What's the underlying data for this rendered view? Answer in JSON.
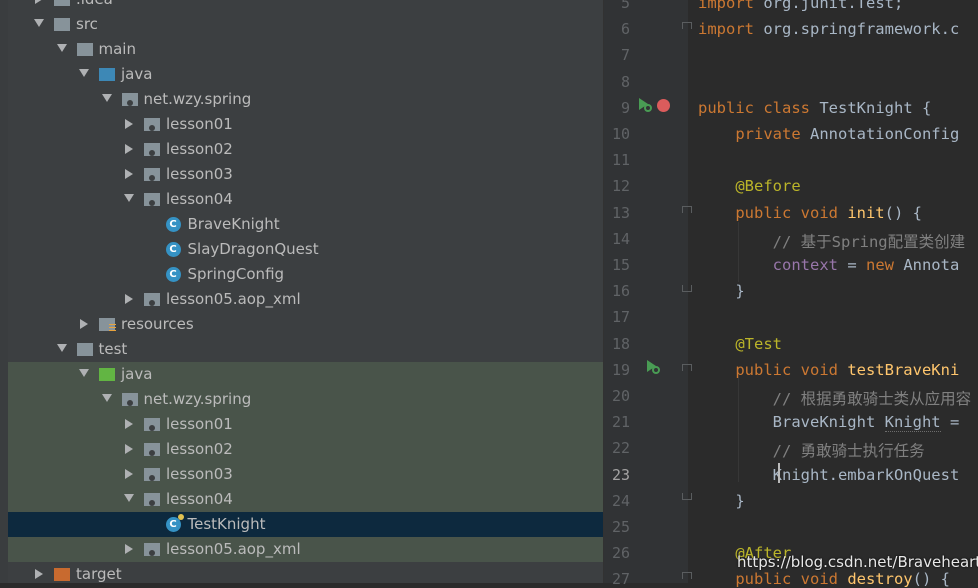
{
  "project_tree": {
    "rows": [
      {
        "label": ".idea",
        "indent": 0,
        "expanded": false,
        "kind": "folder-gray"
      },
      {
        "label": "src",
        "indent": 0,
        "expanded": true,
        "kind": "folder-gray"
      },
      {
        "label": "main",
        "indent": 1,
        "expanded": true,
        "kind": "folder-gray"
      },
      {
        "label": "java",
        "indent": 2,
        "expanded": true,
        "kind": "folder-blue"
      },
      {
        "label": "net.wzy.spring",
        "indent": 3,
        "expanded": true,
        "kind": "package"
      },
      {
        "label": "lesson01",
        "indent": 4,
        "expanded": false,
        "kind": "package"
      },
      {
        "label": "lesson02",
        "indent": 4,
        "expanded": false,
        "kind": "package"
      },
      {
        "label": "lesson03",
        "indent": 4,
        "expanded": false,
        "kind": "package"
      },
      {
        "label": "lesson04",
        "indent": 4,
        "expanded": true,
        "kind": "package"
      },
      {
        "label": "BraveKnight",
        "indent": 5,
        "expanded": null,
        "kind": "class"
      },
      {
        "label": "SlayDragonQuest",
        "indent": 5,
        "expanded": null,
        "kind": "class"
      },
      {
        "label": "SpringConfig",
        "indent": 5,
        "expanded": null,
        "kind": "class"
      },
      {
        "label": "lesson05.aop_xml",
        "indent": 4,
        "expanded": false,
        "kind": "package"
      },
      {
        "label": "resources",
        "indent": 2,
        "expanded": false,
        "kind": "folder-resources"
      },
      {
        "label": "test",
        "indent": 1,
        "expanded": true,
        "kind": "folder-gray"
      },
      {
        "label": "java",
        "indent": 2,
        "expanded": true,
        "kind": "folder-green"
      },
      {
        "label": "net.wzy.spring",
        "indent": 3,
        "expanded": true,
        "kind": "package"
      },
      {
        "label": "lesson01",
        "indent": 4,
        "expanded": false,
        "kind": "package"
      },
      {
        "label": "lesson02",
        "indent": 4,
        "expanded": false,
        "kind": "package"
      },
      {
        "label": "lesson03",
        "indent": 4,
        "expanded": false,
        "kind": "package"
      },
      {
        "label": "lesson04",
        "indent": 4,
        "expanded": true,
        "kind": "package"
      },
      {
        "label": "TestKnight",
        "indent": 5,
        "expanded": null,
        "kind": "test-class",
        "selected": true
      },
      {
        "label": "lesson05.aop_xml",
        "indent": 4,
        "expanded": false,
        "kind": "package"
      },
      {
        "label": "target",
        "indent": 0,
        "expanded": false,
        "kind": "folder-orange"
      }
    ]
  },
  "editor": {
    "current_line": 23,
    "lines": [
      {
        "n": "5",
        "tokens": [
          [
            "kw",
            "import "
          ],
          [
            "plain",
            "org.junit."
          ],
          [
            "plain",
            "Test"
          ],
          [
            "plain",
            ";"
          ]
        ]
      },
      {
        "n": "6",
        "tokens": [
          [
            "kw",
            "import "
          ],
          [
            "plain",
            "org.springframework.c"
          ]
        ]
      },
      {
        "n": "7",
        "tokens": []
      },
      {
        "n": "8",
        "tokens": []
      },
      {
        "n": "9",
        "tokens": [
          [
            "kw",
            "public class "
          ],
          [
            "plain",
            "TestKnight {"
          ]
        ]
      },
      {
        "n": "10",
        "tokens": [
          [
            "plain",
            "    "
          ],
          [
            "kw",
            "private "
          ],
          [
            "plain",
            "AnnotationConfig"
          ]
        ]
      },
      {
        "n": "11",
        "tokens": []
      },
      {
        "n": "12",
        "tokens": [
          [
            "plain",
            "    "
          ],
          [
            "ann",
            "@Before"
          ]
        ]
      },
      {
        "n": "13",
        "tokens": [
          [
            "plain",
            "    "
          ],
          [
            "kw",
            "public void "
          ],
          [
            "fn",
            "init"
          ],
          [
            "plain",
            "() {"
          ]
        ]
      },
      {
        "n": "14",
        "tokens": [
          [
            "plain",
            "        "
          ],
          [
            "cmt",
            "// 基于Spring配置类创建"
          ]
        ]
      },
      {
        "n": "15",
        "tokens": [
          [
            "plain",
            "        "
          ],
          [
            "fld",
            "context"
          ],
          [
            "plain",
            " = "
          ],
          [
            "kw",
            "new "
          ],
          [
            "plain",
            "Annota"
          ]
        ]
      },
      {
        "n": "16",
        "tokens": [
          [
            "plain",
            "    }"
          ]
        ]
      },
      {
        "n": "17",
        "tokens": []
      },
      {
        "n": "18",
        "tokens": [
          [
            "plain",
            "    "
          ],
          [
            "ann",
            "@Test"
          ]
        ]
      },
      {
        "n": "19",
        "tokens": [
          [
            "plain",
            "    "
          ],
          [
            "kw",
            "public void "
          ],
          [
            "fn",
            "testBraveKni"
          ]
        ]
      },
      {
        "n": "20",
        "tokens": [
          [
            "plain",
            "        "
          ],
          [
            "cmt",
            "// 根据勇敢骑士类从应用容"
          ]
        ]
      },
      {
        "n": "21",
        "tokens": [
          [
            "plain",
            "        BraveKnight "
          ],
          [
            "lvar",
            "Knight"
          ],
          [
            "plain",
            " ="
          ]
        ]
      },
      {
        "n": "22",
        "tokens": [
          [
            "plain",
            "        "
          ],
          [
            "cmt",
            "// 勇敢骑士执行任务"
          ]
        ]
      },
      {
        "n": "23",
        "tokens": [
          [
            "plain",
            "        Knight.embarkOnQuest"
          ]
        ]
      },
      {
        "n": "24",
        "tokens": [
          [
            "plain",
            "    }"
          ]
        ]
      },
      {
        "n": "25",
        "tokens": []
      },
      {
        "n": "26",
        "tokens": [
          [
            "plain",
            "    "
          ],
          [
            "ann",
            "@After"
          ]
        ]
      },
      {
        "n": "27",
        "tokens": [
          [
            "plain",
            "    "
          ],
          [
            "kw",
            "public void "
          ],
          [
            "fn",
            "destroy"
          ],
          [
            "plain",
            "() {"
          ]
        ]
      }
    ]
  },
  "watermark": "https://blog.csdn.net/Braveheart_",
  "colors": {
    "tree_bg": "#3c3f41",
    "test_region_bg": "#49544a",
    "selection_bg": "#0d293e",
    "editor_bg": "#2b2b2b",
    "keyword": "#cc7832",
    "annotation": "#bbb529",
    "method": "#ffc66d",
    "field": "#9876aa",
    "comment": "#808080"
  }
}
